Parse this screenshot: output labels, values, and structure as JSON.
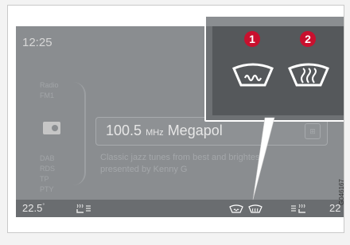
{
  "screen": {
    "clock": "12:25",
    "source_label_lines": [
      "Radio",
      "FM1"
    ],
    "info_lines": [
      "DAB",
      "RDS",
      "TP",
      "PTY"
    ],
    "station": {
      "frequency": "100.5",
      "unit": "MHz",
      "name": "Megapol"
    },
    "rds_text_lines": [
      "Classic jazz tunes from best and brightest",
      "presented by Kenny G"
    ]
  },
  "status_bar": {
    "left_temp": "22.5",
    "left_temp_unit": "°",
    "right_temp": "22"
  },
  "callout": {
    "badge_1": "1",
    "badge_2": "2",
    "icon_1": "windshield-defrost-icon",
    "icon_2": "rear-window-defrost-icon"
  },
  "figure_id": "G046167",
  "colors": {
    "badge": "#c8102e",
    "screen": "#8a8d90",
    "status_bar": "#6a6d70"
  }
}
